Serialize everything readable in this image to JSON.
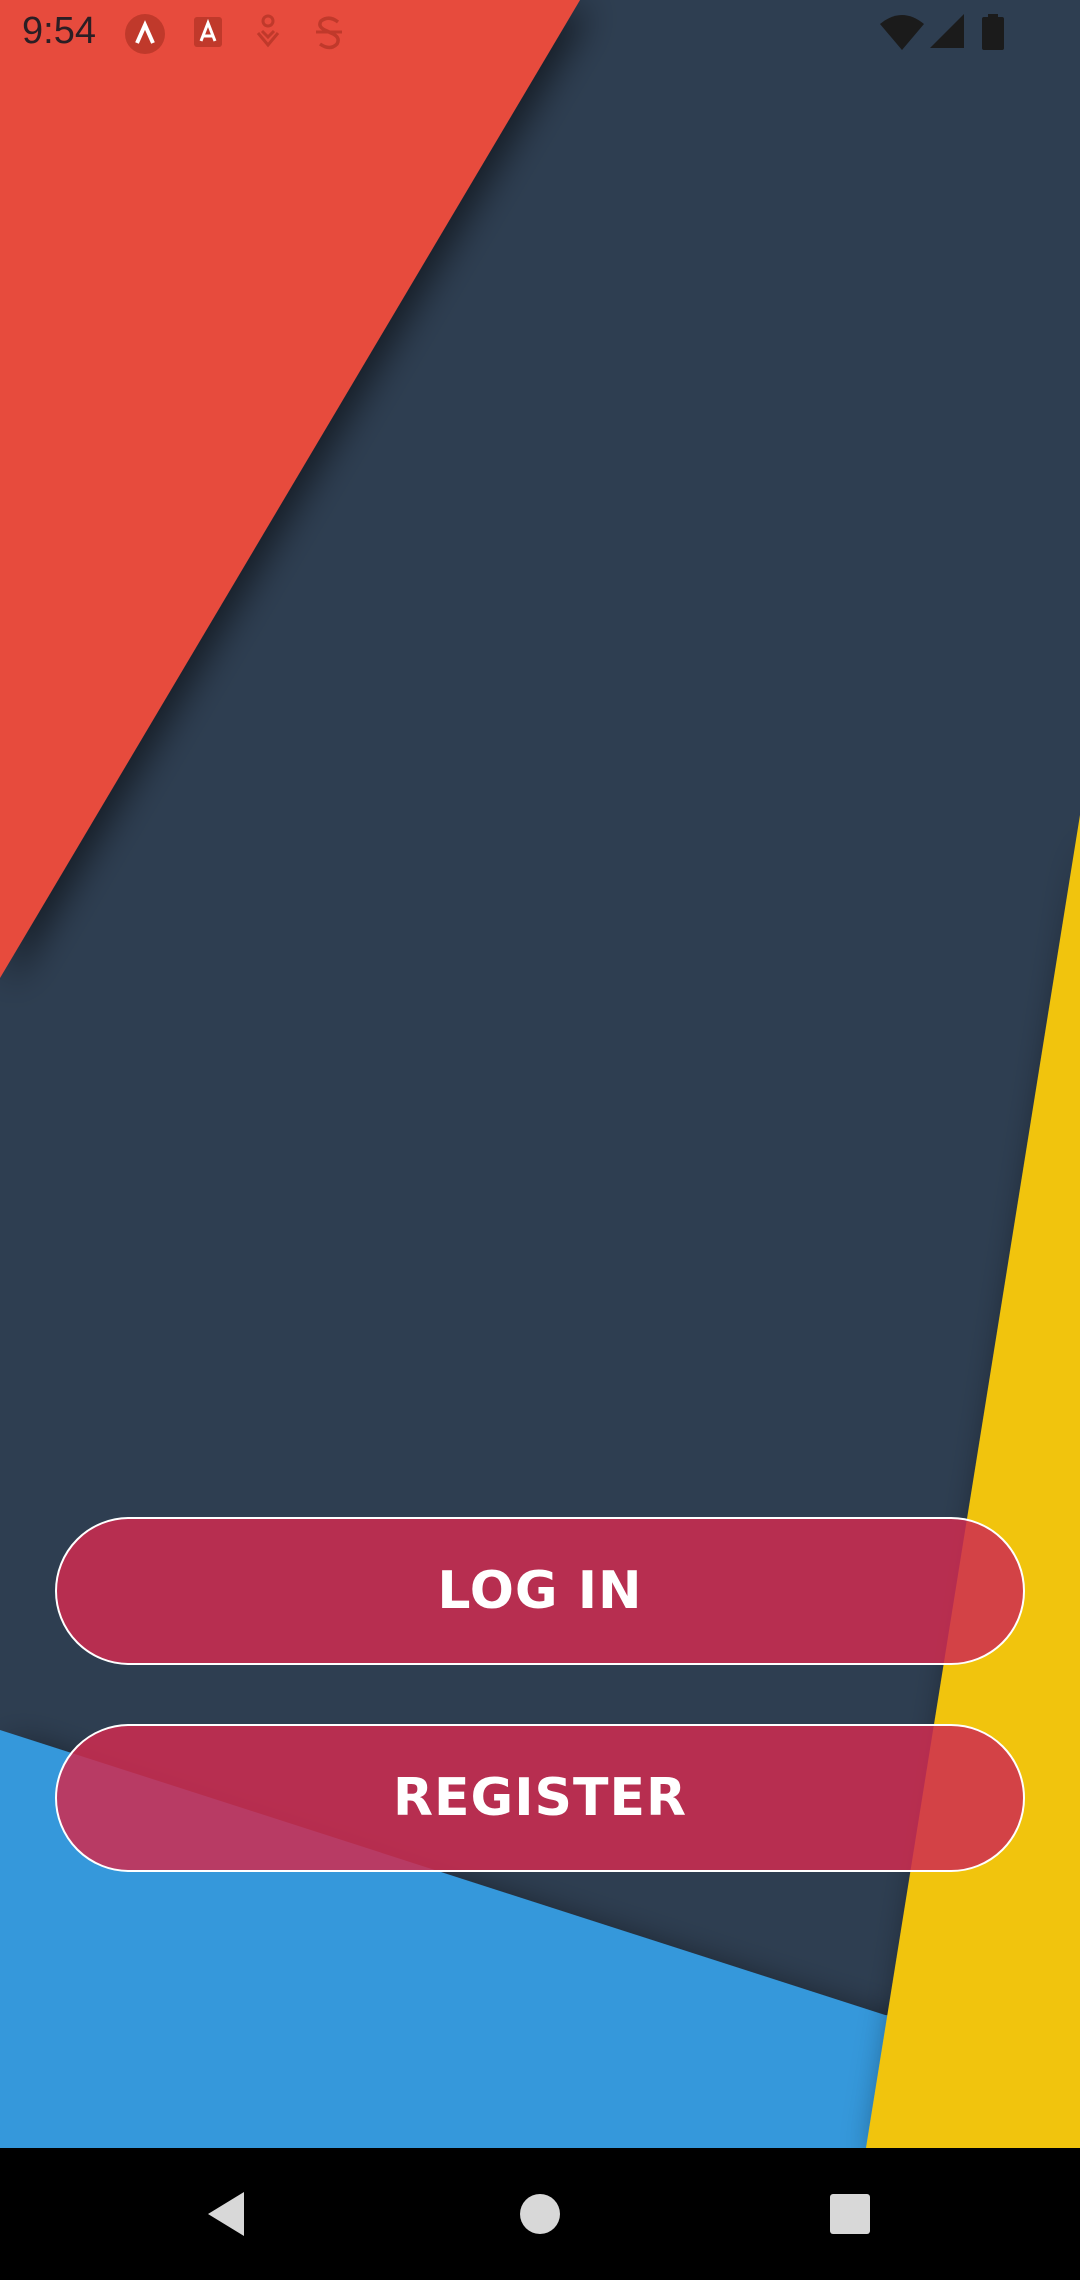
{
  "status_bar": {
    "time": "9:54",
    "icons": [
      "app-a-icon",
      "app-store-icon",
      "location-pin-icon",
      "strikethrough-s-icon"
    ],
    "right_icons": [
      "wifi-icon",
      "cellular-signal-icon",
      "battery-icon"
    ]
  },
  "actions": {
    "login_label": "LOG IN",
    "register_label": "REGISTER"
  },
  "nav_bar": {
    "items": [
      "back-icon",
      "home-icon",
      "recents-icon"
    ]
  },
  "colors": {
    "background": "#2e3e51",
    "red_panel": "#e74c3c",
    "yellow_panel": "#f1c40f",
    "blue_panel": "#3498db",
    "button_fill": "#ce2c50",
    "button_border": "#ffffff"
  }
}
